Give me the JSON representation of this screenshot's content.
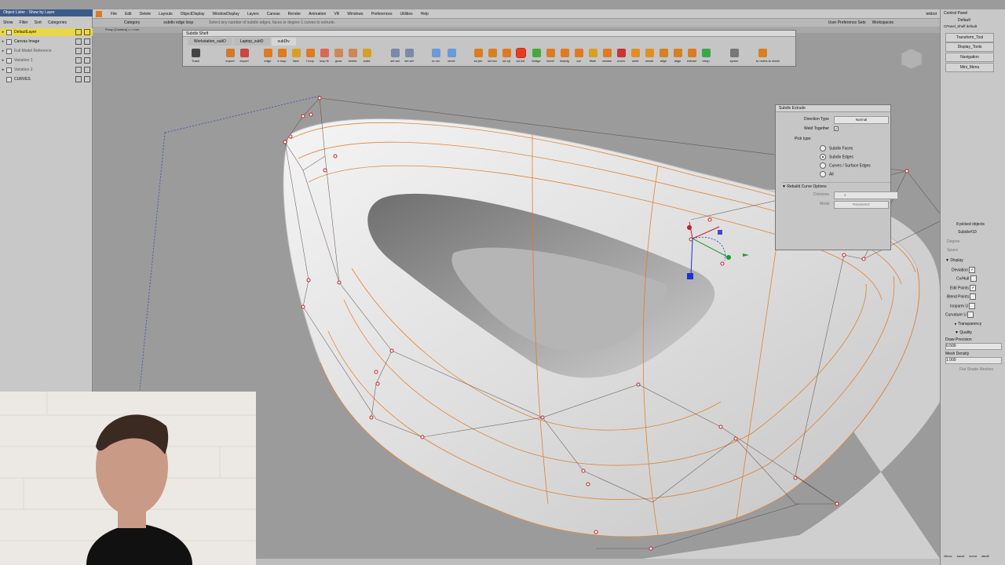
{
  "object_lister": {
    "title": "Object Lister - Show by Layer",
    "menu": [
      "Show",
      "Filter",
      "Sort",
      "Categories"
    ],
    "layers": [
      {
        "name": "DefaultLayer",
        "selected": true
      },
      {
        "name": "Canvas Image"
      },
      {
        "name": "Full Model Reference"
      },
      {
        "name": "Variation 1"
      },
      {
        "name": "Variation 2"
      },
      {
        "name": "CURVES"
      }
    ]
  },
  "menubar": {
    "items": [
      "File",
      "Edit",
      "Delete",
      "Layouts",
      "ObjectDisplay",
      "WindowDisplay",
      "Layers",
      "Canvas",
      "Render",
      "Animation",
      "VR",
      "Windows",
      "Preferences",
      "Utilities",
      "Help"
    ],
    "user_pref_sets": "User Preference Sets",
    "workspaces": "Workspaces",
    "user": "tekbot"
  },
  "statusbar": {
    "category_label": "Category",
    "tool_label": "subdiv edge loop",
    "prompt": "Select any number of subdiv edges, faces or degree 1 curves to extrude."
  },
  "viewport": {
    "label": "Persp [Camera] <-> mm"
  },
  "shelf": {
    "title": "Subdiv Shelf",
    "tabs": [
      "Workstation_subD",
      "Laptop_subD",
      "subDiv"
    ],
    "tools": [
      "import",
      "export",
      "edge",
      "e loop",
      "face",
      "f loop",
      "loop fe",
      "grow",
      "shrink",
      "subd",
      "sel set",
      "sel set",
      "cv crv",
      "circle",
      "sd pln",
      "sd box",
      "sd cyl",
      "sd ext",
      "bridge",
      "bevel",
      "insedg",
      "cut",
      "fllsle",
      "crease",
      "uncrs",
      "weld",
      "unwld",
      "align",
      "align",
      "extract",
      "retop",
      "symm",
      "to nurbs to mesh"
    ],
    "trash_label": "Trash"
  },
  "extrude": {
    "title": "Subdiv Extrude",
    "direction_type_label": "Direction Type",
    "direction_type_value": "Normal",
    "weld_together_label": "Weld Together",
    "pick_type_label": "Pick type:",
    "pick_options": [
      "Subdiv Faces",
      "Subdiv Edges",
      "Curves / Surface Edges",
      "All"
    ],
    "pick_selected": "Subdiv Edges",
    "rebuild_section": "Rebuild Curve Options",
    "divisions_label": "Divisions",
    "divisions_value": "1",
    "mode_label": "Mode",
    "mode_value": "Parametric"
  },
  "control_panel": {
    "title": "Control Panel",
    "preset": "Default",
    "shelf_name": "CPanel_Shelf default",
    "buttons": [
      "Transform_Tool",
      "Display_Tools",
      "Navigation",
      "Mini_Menu"
    ],
    "picked": "8 picked objects",
    "object_name": "Subdiv#10",
    "degree_label": "Degree",
    "spans_label": "Spans",
    "display_section": "Display",
    "display_items": [
      "Deviation",
      "Cv/Hull",
      "Edit Points",
      "Blend Points",
      "Isoparm U",
      "Curvature U"
    ],
    "transparency_section": "Transparency",
    "quality_section": "Quality",
    "draw_precision_label": "Draw Precision",
    "draw_precision_value": "0.500",
    "mesh_density_label": "Mesh Density",
    "mesh_density_value": "1.000",
    "flat_shade_label": "Flat Shade Meshes",
    "bottom_tools": [
      "vfmov",
      "savof",
      "curva",
      "stedit"
    ]
  },
  "colors": {
    "accent": "#e07a20",
    "selection": "#e8d74a",
    "viewport_bg": "#9b9b9b"
  }
}
